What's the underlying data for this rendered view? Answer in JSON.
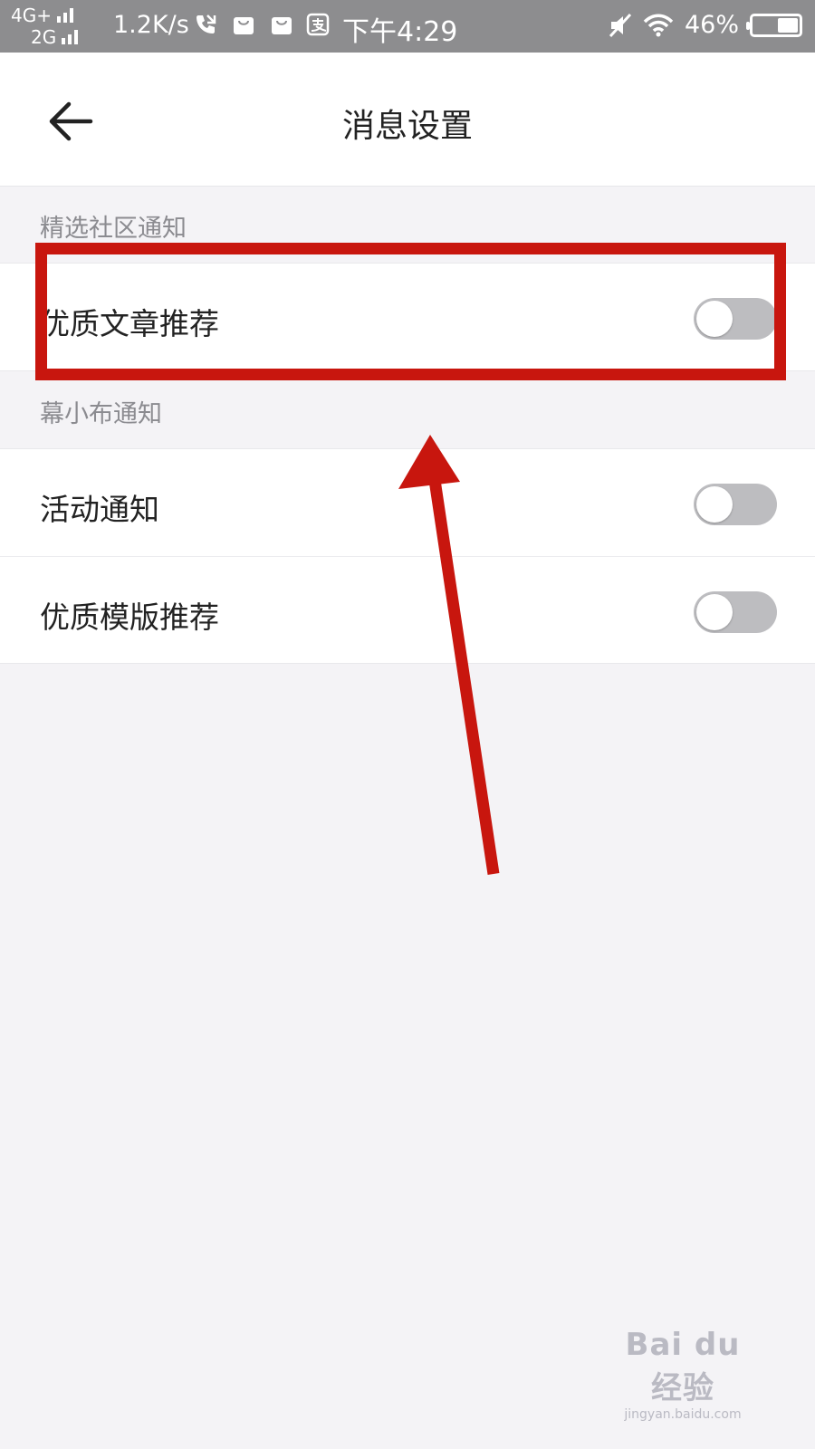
{
  "status_bar": {
    "net_top": "4G+",
    "net_bottom": "2G",
    "speed": "1.2K/s",
    "time": "下午4:29",
    "battery": "46%",
    "battery_level": 0.46,
    "icons": [
      "signal-icon",
      "call-icon",
      "shopping-bag-icon",
      "shopping-bag-icon",
      "alipay-icon",
      "mute-icon",
      "wifi-icon",
      "battery-icon"
    ]
  },
  "header": {
    "title": "消息设置",
    "back_icon": "back-arrow-icon"
  },
  "sections": [
    {
      "label": "精选社区通知",
      "items": [
        {
          "label": "优质文章推荐",
          "toggle_on": false
        }
      ]
    },
    {
      "label": "幕小布通知",
      "items": [
        {
          "label": "活动通知",
          "toggle_on": false
        },
        {
          "label": "优质模版推荐",
          "toggle_on": false
        }
      ]
    }
  ],
  "annotation": {
    "color": "#c8160e"
  },
  "watermark": {
    "logo_text": "Bai du 经验",
    "url": "jingyan.baidu.com"
  },
  "colors": {
    "status_bar": "#8d8d8f",
    "background": "#f4f3f6",
    "toggle_off": "#bdbdc0",
    "section_label": "#8b8b90"
  }
}
